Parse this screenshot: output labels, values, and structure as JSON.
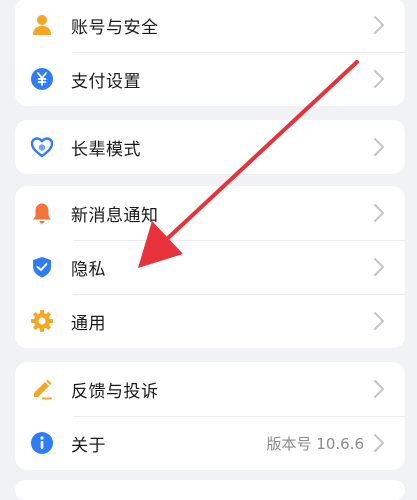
{
  "settings": {
    "group1": [
      {
        "label": "账号与安全",
        "icon": "person-icon",
        "color": "#f5a623"
      },
      {
        "label": "支付设置",
        "icon": "yuan-icon",
        "color": "#2f7df6"
      }
    ],
    "group2": [
      {
        "label": "长辈模式",
        "icon": "heart-icon",
        "color": "#2f7df6"
      }
    ],
    "group3": [
      {
        "label": "新消息通知",
        "icon": "bell-icon",
        "color": "#f4733a"
      },
      {
        "label": "隐私",
        "icon": "shield-icon",
        "color": "#2f7df6"
      },
      {
        "label": "通用",
        "icon": "gear-icon",
        "color": "#f5a623"
      }
    ],
    "group4": [
      {
        "label": "反馈与投诉",
        "icon": "pencil-icon",
        "color": "#f5a623"
      },
      {
        "label": "关于",
        "icon": "info-icon",
        "color": "#2f7df6",
        "value": "版本号 10.6.6"
      }
    ]
  },
  "annotation": {
    "arrow_color": "#e8323b"
  }
}
